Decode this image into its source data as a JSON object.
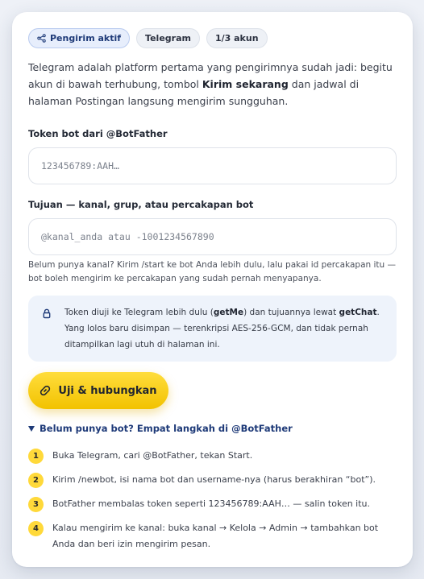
{
  "chips": [
    {
      "label": "Pengirim aktif",
      "icon": "share-icon",
      "active": true
    },
    {
      "label": "Telegram",
      "active": false
    },
    {
      "label": "1/3 akun",
      "active": false
    }
  ],
  "intro": {
    "before": "Telegram adalah platform pertama yang pengirimnya sudah jadi: begitu akun di bawah terhubung, tombol ",
    "bold": "Kirim sekarang",
    "after": " dan jadwal di halaman Postingan langsung mengirim sungguhan."
  },
  "token": {
    "label": "Token bot dari @BotFather",
    "placeholder": "123456789:AAH…"
  },
  "target": {
    "label": "Tujuan — kanal, grup, atau percakapan bot",
    "placeholder": "@kanal_anda atau -1001234567890"
  },
  "hint": "Belum punya kanal? Kirim /start ke bot Anda lebih dulu, lalu pakai id percakapan itu — bot boleh mengirim ke percakapan yang sudah pernah menyapanya.",
  "note": {
    "icon": "lock-icon",
    "part1": "Token diuji ke Telegram lebih dulu (",
    "bold1": "getMe",
    "part2": ") dan tujuannya lewat ",
    "bold2": "getChat",
    "part3": ". Yang lolos baru disimpan — terenkripsi AES-256-GCM, dan tidak pernah ditampilkan lagi utuh di halaman ini."
  },
  "button": {
    "label": "Uji & hubungkan",
    "icon": "link-icon"
  },
  "guide": {
    "summary": "Belum punya bot? Empat langkah di @BotFather",
    "steps": [
      {
        "num": "1",
        "text": "Buka Telegram, cari @BotFather, tekan Start."
      },
      {
        "num": "2",
        "text": "Kirim /newbot, isi nama bot dan username-nya (harus berakhiran “bot”)."
      },
      {
        "num": "3",
        "text": "BotFather membalas token seperti 123456789:AAH… — salin token itu."
      },
      {
        "num": "4",
        "text": "Kalau mengirim ke kanal: buka kanal → Kelola → Admin → tambahkan bot Anda dan beri izin mengirim pesan."
      }
    ]
  },
  "colors": {
    "accent": "#f5c800",
    "brand_blue": "#1e3a78",
    "note_bg": "#eef3fb"
  }
}
